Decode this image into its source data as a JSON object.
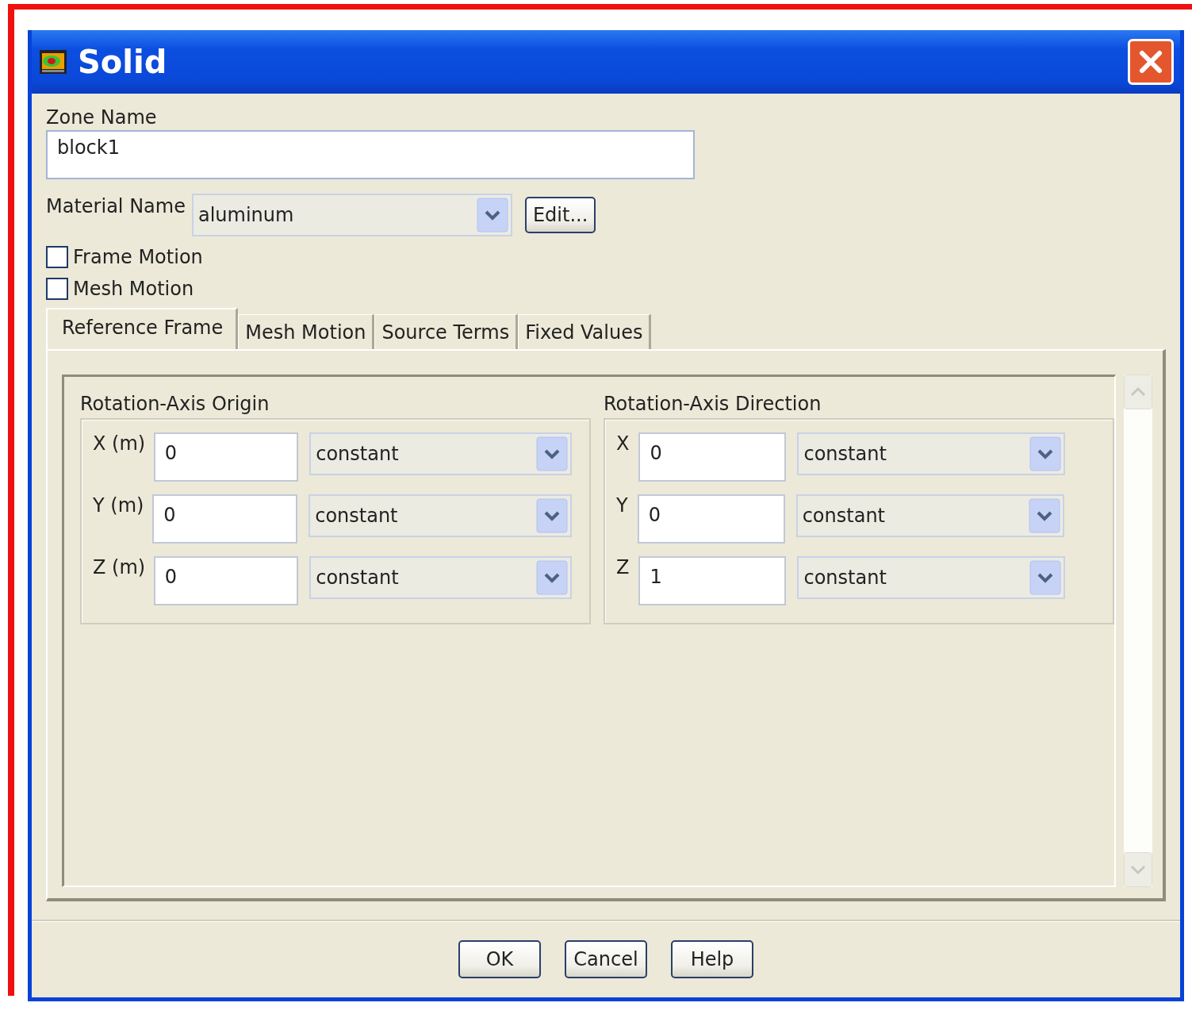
{
  "window": {
    "title": "Solid"
  },
  "zone_name": {
    "label": "Zone Name",
    "value": "block1"
  },
  "material": {
    "label": "Material Name",
    "value": "aluminum",
    "edit_button": "Edit..."
  },
  "options": [
    {
      "label": "Frame Motion",
      "checked": false
    },
    {
      "label": "Mesh Motion",
      "checked": false
    }
  ],
  "tabs": [
    {
      "label": "Reference Frame",
      "selected": true
    },
    {
      "label": "Mesh Motion",
      "selected": false
    },
    {
      "label": "Source Terms",
      "selected": false
    },
    {
      "label": "Fixed Values",
      "selected": false
    }
  ],
  "groups": [
    {
      "title": "Rotation-Axis Origin",
      "rows": [
        {
          "label": "X (m)",
          "value": "0",
          "method": "constant"
        },
        {
          "label": "Y (m)",
          "value": "0",
          "method": "constant"
        },
        {
          "label": "Z (m)",
          "value": "0",
          "method": "constant"
        }
      ]
    },
    {
      "title": "Rotation-Axis Direction",
      "rows": [
        {
          "label": "X",
          "value": "0",
          "method": "constant"
        },
        {
          "label": "Y",
          "value": "0",
          "method": "constant"
        },
        {
          "label": "Z",
          "value": "1",
          "method": "constant"
        }
      ]
    }
  ],
  "buttons": [
    "OK",
    "Cancel",
    "Help"
  ]
}
